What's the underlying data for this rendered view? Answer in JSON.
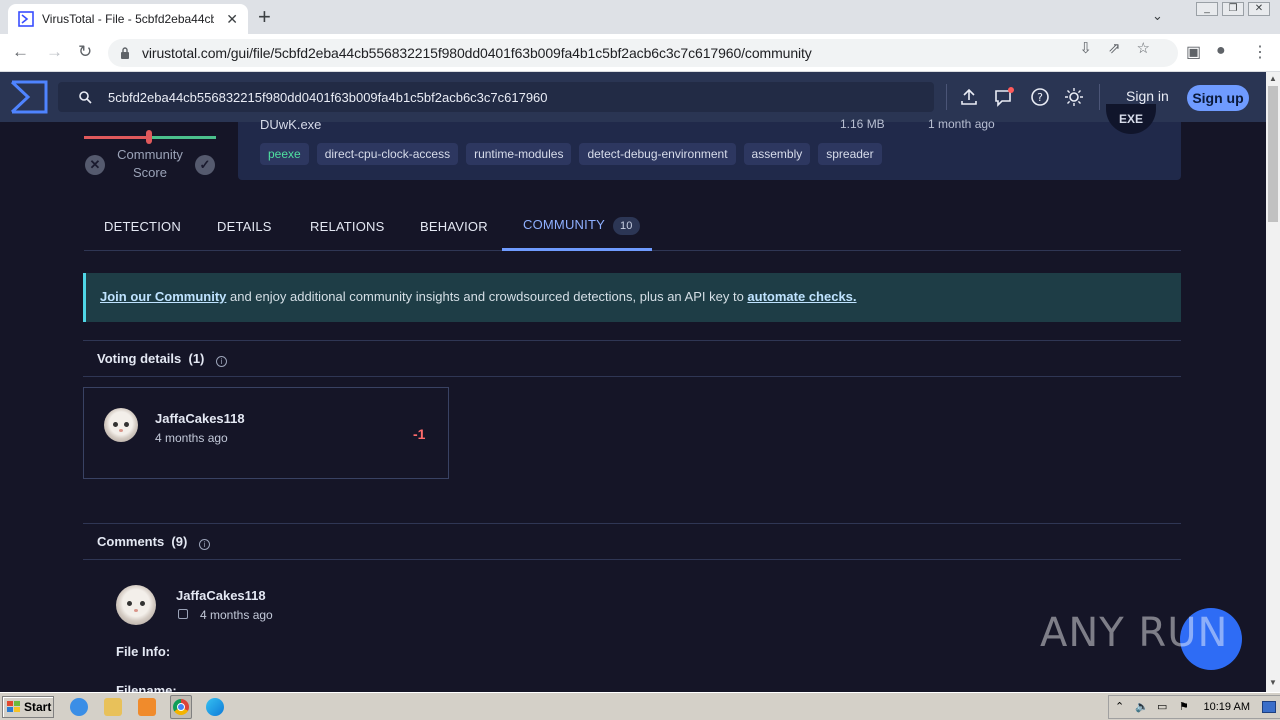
{
  "browser": {
    "tab_title": "VirusTotal - File - 5cbfd2eba44cb556",
    "url": "virustotal.com/gui/file/5cbfd2eba44cb556832215f980dd0401f63b009fa4b1c5bf2acb6c3c7c617960/community"
  },
  "header": {
    "search_value": "5cbfd2eba44cb556832215f980dd0401f63b009fa4b1c5bf2acb6c3c7c617960",
    "sign_in": "Sign in",
    "sign_up": "Sign up"
  },
  "summary": {
    "community_score_label": "Community Score",
    "file_name": "DUwK.exe",
    "file_size": "1.16 MB",
    "file_age": "1 month ago",
    "file_type": "EXE",
    "tags": [
      "peexe",
      "direct-cpu-clock-access",
      "runtime-modules",
      "detect-debug-environment",
      "assembly",
      "spreader"
    ]
  },
  "tabs": [
    {
      "label": "DETECTION"
    },
    {
      "label": "DETAILS"
    },
    {
      "label": "RELATIONS"
    },
    {
      "label": "BEHAVIOR"
    },
    {
      "label": "COMMUNITY",
      "count": "10"
    }
  ],
  "banner": {
    "link1": "Join our Community",
    "middle": " and enjoy additional community insights and crowdsourced detections, plus an API key to ",
    "link2": "automate checks."
  },
  "voting": {
    "title": "Voting details",
    "count": "(1)",
    "user": "JaffaCakes118",
    "time": "4 months ago",
    "value": "-1"
  },
  "comments": {
    "title": "Comments",
    "count": "(9)",
    "user": "JaffaCakes118",
    "time": "4 months ago",
    "line1": "File Info:",
    "line2": "Filename:"
  },
  "watermark": "ANY RUN",
  "taskbar": {
    "start": "Start",
    "clock": "10:19 AM"
  }
}
